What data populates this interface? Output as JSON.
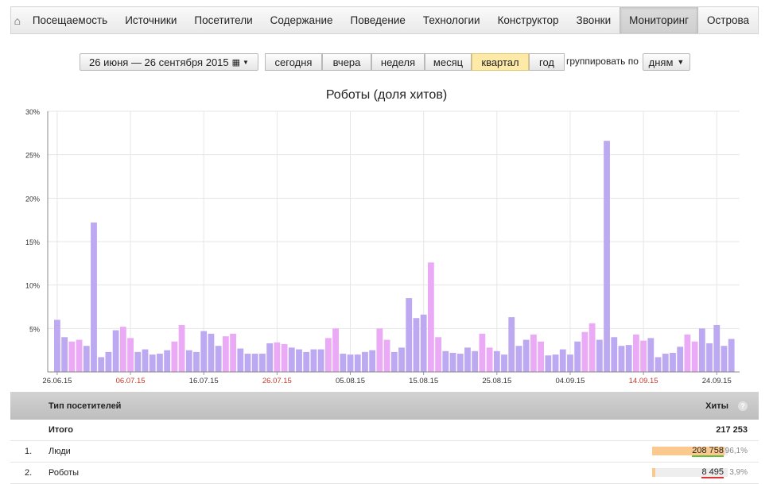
{
  "nav": {
    "home_icon": "home-icon",
    "items": [
      "Посещаемость",
      "Источники",
      "Посетители",
      "Содержание",
      "Поведение",
      "Технологии",
      "Конструктор",
      "Звонки",
      "Мониторинг",
      "Острова"
    ],
    "active": "Мониторинг"
  },
  "toolbar": {
    "date_range": "26 июня — 26 сентября 2015",
    "calendar_icon": "calendar-icon",
    "periods": [
      "сегодня",
      "вчера",
      "неделя",
      "месяц",
      "квартал",
      "год"
    ],
    "selected_period": "квартал",
    "group_label": "группировать по",
    "group_value": "дням"
  },
  "chart_title": "Роботы (доля хитов)",
  "chart_data": {
    "type": "bar",
    "title": "Роботы (доля хитов)",
    "ylim": [
      0,
      30
    ],
    "yticks": [
      "30%",
      "25%",
      "20%",
      "15%",
      "10%",
      "5%"
    ],
    "xticks": [
      {
        "label": "26.06.15",
        "weekend": false
      },
      {
        "label": "06.07.15",
        "weekend": true
      },
      {
        "label": "16.07.15",
        "weekend": false
      },
      {
        "label": "26.07.15",
        "weekend": true
      },
      {
        "label": "05.08.15",
        "weekend": false
      },
      {
        "label": "15.08.15",
        "weekend": false
      },
      {
        "label": "25.08.15",
        "weekend": false
      },
      {
        "label": "04.09.15",
        "weekend": false
      },
      {
        "label": "14.09.15",
        "weekend": true
      },
      {
        "label": "24.09.15",
        "weekend": false
      }
    ],
    "grid": true,
    "colors": {
      "weekday": "#bda9f2",
      "weekend": "#ebaaf5"
    },
    "values": [
      6.0,
      4.0,
      3.5,
      3.7,
      3.0,
      17.2,
      1.7,
      2.3,
      4.8,
      5.2,
      3.9,
      2.3,
      2.6,
      2.0,
      2.1,
      2.5,
      3.5,
      5.4,
      2.5,
      2.3,
      4.7,
      4.4,
      3.0,
      4.1,
      4.4,
      2.7,
      2.1,
      2.1,
      2.1,
      3.3,
      3.4,
      3.2,
      2.8,
      2.6,
      2.3,
      2.6,
      2.6,
      3.9,
      5.0,
      2.1,
      2.0,
      2.0,
      2.3,
      2.5,
      5.0,
      3.7,
      2.3,
      2.8,
      8.5,
      6.2,
      6.6,
      12.6,
      4.0,
      2.4,
      2.2,
      2.1,
      2.8,
      2.4,
      4.4,
      2.8,
      2.4,
      2.0,
      6.3,
      3.0,
      3.7,
      4.3,
      3.5,
      1.9,
      2.0,
      2.6,
      2.0,
      3.5,
      4.6,
      5.6,
      3.7,
      26.6,
      4.0,
      3.0,
      3.1,
      4.3,
      3.6,
      3.9,
      1.7,
      2.1,
      2.2,
      2.9,
      4.3,
      3.5,
      5.0,
      3.3,
      5.4,
      3.0,
      3.8
    ],
    "weekend": [
      false,
      false,
      true,
      true,
      false,
      false,
      false,
      false,
      false,
      true,
      true,
      false,
      false,
      false,
      false,
      false,
      true,
      true,
      false,
      false,
      false,
      false,
      false,
      true,
      true,
      false,
      false,
      false,
      false,
      false,
      true,
      true,
      false,
      false,
      false,
      false,
      false,
      true,
      true,
      false,
      false,
      false,
      false,
      false,
      true,
      true,
      false,
      false,
      false,
      false,
      false,
      true,
      true,
      false,
      false,
      false,
      false,
      false,
      true,
      true,
      false,
      false,
      false,
      false,
      false,
      true,
      true,
      false,
      false,
      false,
      false,
      false,
      true,
      true,
      false,
      false,
      false,
      false,
      false,
      true,
      true,
      false,
      false,
      false,
      false,
      false,
      true,
      true,
      false,
      false,
      false,
      false,
      false
    ]
  },
  "table": {
    "col_type": "Тип посетителей",
    "col_hits": "Хиты",
    "help_icon": "help-icon",
    "total_label": "Итого",
    "total_value": "217 253",
    "rows": [
      {
        "num": "1.",
        "name": "Люди",
        "hits": "208 758",
        "pct": "96,1%",
        "share": 0.961
      },
      {
        "num": "2.",
        "name": "Роботы",
        "hits": "8 495",
        "pct": "3,9%",
        "share": 0.039
      }
    ]
  }
}
